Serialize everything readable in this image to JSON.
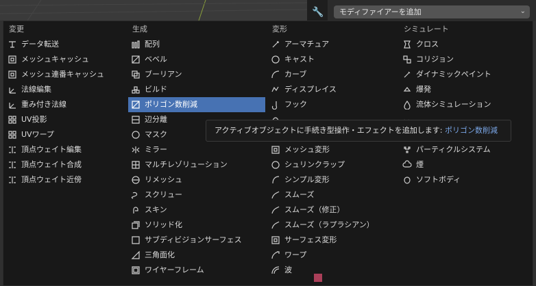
{
  "dropdown": {
    "label": "モディファイアーを追加"
  },
  "columns": [
    {
      "header": "変更",
      "items": [
        {
          "label": "データ転送",
          "icon": "data-transfer-icon"
        },
        {
          "label": "メッシュキャッシュ",
          "icon": "mesh-cache-icon"
        },
        {
          "label": "メッシュ連番キャッシュ",
          "icon": "mesh-seq-cache-icon"
        },
        {
          "label": "法線編集",
          "icon": "normal-edit-icon"
        },
        {
          "label": "重み付き法線",
          "icon": "weighted-normal-icon"
        },
        {
          "label": "UV投影",
          "icon": "uv-project-icon"
        },
        {
          "label": "UVワープ",
          "icon": "uv-warp-icon"
        },
        {
          "label": "頂点ウェイト編集",
          "icon": "vertex-weight-edit-icon"
        },
        {
          "label": "頂点ウェイト合成",
          "icon": "vertex-weight-mix-icon"
        },
        {
          "label": "頂点ウェイト近傍",
          "icon": "vertex-weight-proximity-icon"
        }
      ]
    },
    {
      "header": "生成",
      "items": [
        {
          "label": "配列",
          "icon": "array-icon"
        },
        {
          "label": "ベベル",
          "icon": "bevel-icon"
        },
        {
          "label": "ブーリアン",
          "icon": "boolean-icon"
        },
        {
          "label": "ビルド",
          "icon": "build-icon"
        },
        {
          "label": "ポリゴン数削減",
          "icon": "decimate-icon",
          "highlight": true
        },
        {
          "label": "辺分離",
          "icon": "edge-split-icon"
        },
        {
          "label": "マスク",
          "icon": "mask-icon"
        },
        {
          "label": "ミラー",
          "icon": "mirror-icon"
        },
        {
          "label": "マルチレゾリューション",
          "icon": "multires-icon"
        },
        {
          "label": "リメッシュ",
          "icon": "remesh-icon"
        },
        {
          "label": "スクリュー",
          "icon": "screw-icon"
        },
        {
          "label": "スキン",
          "icon": "skin-icon"
        },
        {
          "label": "ソリッド化",
          "icon": "solidify-icon"
        },
        {
          "label": "サブディビジョンサーフェス",
          "icon": "subsurf-icon"
        },
        {
          "label": "三角面化",
          "icon": "triangulate-icon"
        },
        {
          "label": "ワイヤーフレーム",
          "icon": "wireframe-icon"
        }
      ]
    },
    {
      "header": "変形",
      "items": [
        {
          "label": "アーマチュア",
          "icon": "armature-icon"
        },
        {
          "label": "キャスト",
          "icon": "cast-icon"
        },
        {
          "label": "カーブ",
          "icon": "curve-icon"
        },
        {
          "label": "ディスプレイス",
          "icon": "displace-icon"
        },
        {
          "label": "フック",
          "icon": "hook-icon"
        },
        {
          "label": "",
          "icon": "laplacian-icon"
        },
        {
          "label": "",
          "icon": "lattice-icon"
        },
        {
          "label": "メッシュ変形",
          "icon": "mesh-deform-icon"
        },
        {
          "label": "シュリンクラップ",
          "icon": "shrinkwrap-icon"
        },
        {
          "label": "シンプル変形",
          "icon": "simple-deform-icon"
        },
        {
          "label": "スムーズ",
          "icon": "smooth-icon"
        },
        {
          "label": "スムーズ（修正）",
          "icon": "smooth-corrective-icon"
        },
        {
          "label": "スムーズ（ラプラシアン）",
          "icon": "smooth-laplacian-icon"
        },
        {
          "label": "サーフェス変形",
          "icon": "surface-deform-icon"
        },
        {
          "label": "ワープ",
          "icon": "warp-icon"
        },
        {
          "label": "波",
          "icon": "wave-icon"
        }
      ]
    },
    {
      "header": "シミュレート",
      "items": [
        {
          "label": "クロス",
          "icon": "cloth-icon"
        },
        {
          "label": "コリジョン",
          "icon": "collision-icon"
        },
        {
          "label": "ダイナミックペイント",
          "icon": "dynamic-paint-icon"
        },
        {
          "label": "爆発",
          "icon": "explode-icon"
        },
        {
          "label": "流体シミュレーション",
          "icon": "fluid-icon"
        },
        {
          "label": "",
          "icon": "ocean-icon"
        },
        {
          "label": "",
          "icon": "particle-instance-icon"
        },
        {
          "label": "パーティクルシステム",
          "icon": "particle-system-icon"
        },
        {
          "label": "煙",
          "icon": "smoke-icon"
        },
        {
          "label": "ソフトボディ",
          "icon": "soft-body-icon"
        }
      ]
    }
  ],
  "tooltip": {
    "text": "アクティブオブジェクトに手続き型操作・エフェクトを追加します: ",
    "highlight": "ポリゴン数削減"
  }
}
